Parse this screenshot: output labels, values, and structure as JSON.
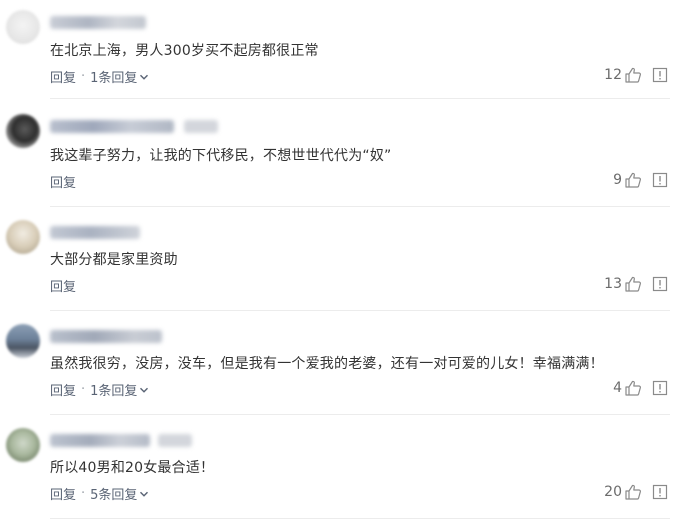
{
  "comments": [
    {
      "text": "在北京上海，男人300岁买不起房都很正常",
      "reply_label": "回复",
      "separator": "·",
      "replies_label": "1条回复",
      "likes": "12"
    },
    {
      "text": "我这辈子努力，让我的下代移民，不想世世代代为“奴”",
      "reply_label": "回复",
      "likes": "9"
    },
    {
      "text": "大部分都是家里资助",
      "reply_label": "回复",
      "likes": "13"
    },
    {
      "text": "虽然我很穷，没房，没车，但是我有一个爱我的老婆，还有一对可爱的儿女！幸福满满！",
      "reply_label": "回复",
      "separator": "·",
      "replies_label": "1条回复",
      "likes": "4"
    },
    {
      "text": "所以40男和20女最合适！",
      "reply_label": "回复",
      "separator": "·",
      "replies_label": "5条回复",
      "likes": "20"
    }
  ],
  "icons": {
    "like": "thumbs-up-icon",
    "report": "report-icon",
    "expand": "chevron-down-icon"
  },
  "colors": {
    "text": "#333333",
    "action": "#5a6475",
    "icon": "#8a8a8a",
    "divider": "#ececec"
  }
}
